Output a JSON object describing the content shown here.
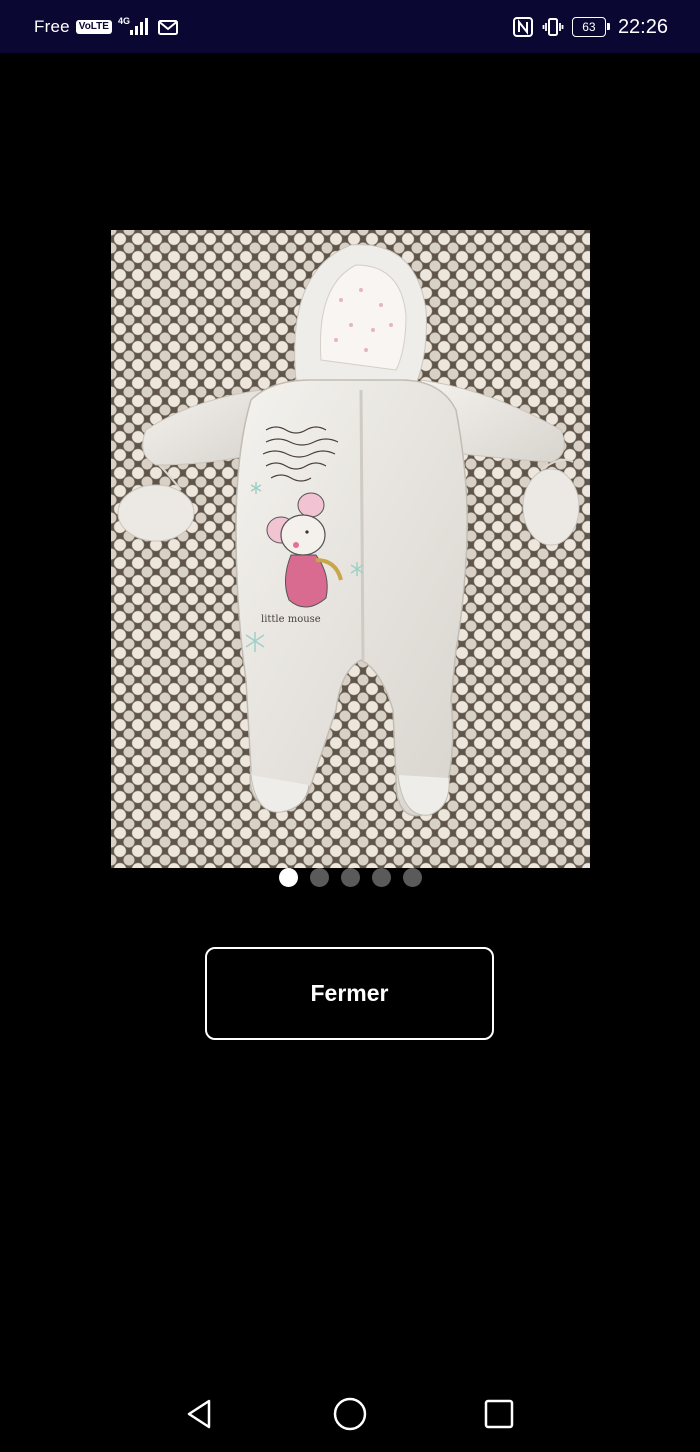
{
  "status_bar": {
    "carrier": "Free",
    "volte_label": "VoLTE",
    "network_type": "4G",
    "battery_level": "63",
    "time": "22:26",
    "icons": [
      "signal-icon",
      "mail-icon",
      "nfc-icon",
      "vibrate-icon",
      "battery-icon"
    ]
  },
  "gallery": {
    "image_alt": "",
    "page_count": 5,
    "active_page": 1
  },
  "actions": {
    "close_label": "Fermer"
  },
  "nav_bar": {
    "icons": [
      "back-icon",
      "home-icon",
      "recents-icon"
    ]
  },
  "colors": {
    "status_bar_bg": "#0b0733",
    "background": "#000000",
    "dot_active": "#ffffff",
    "dot_inactive": "#5a5a5a"
  }
}
